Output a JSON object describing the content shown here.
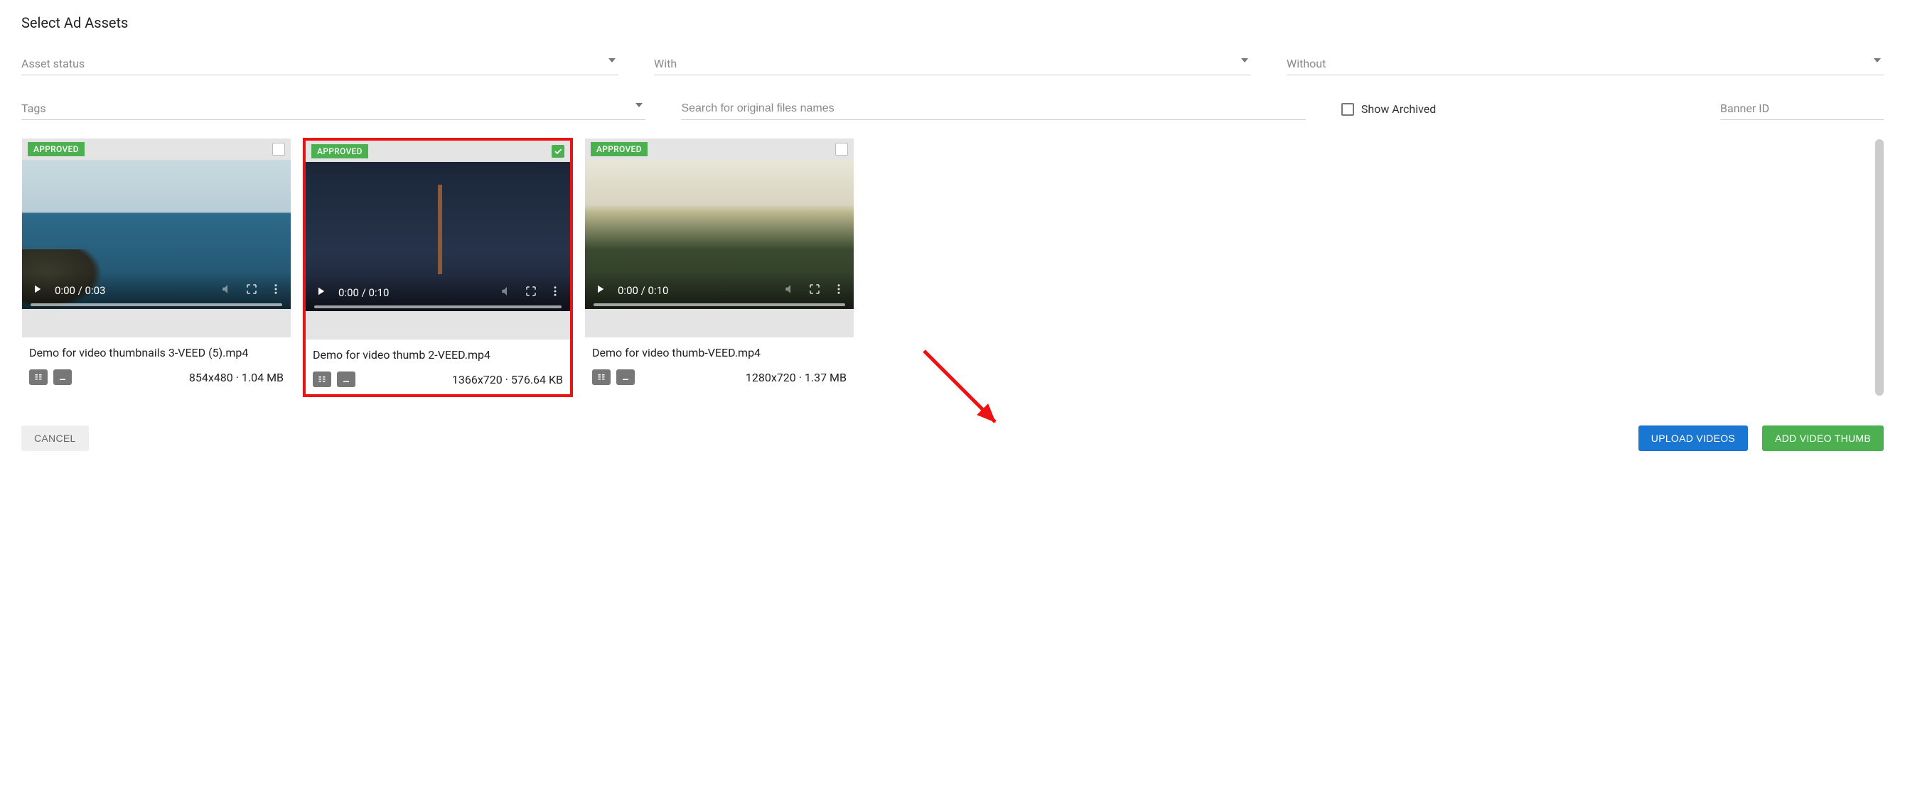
{
  "page": {
    "title": "Select Ad Assets"
  },
  "filters": {
    "asset_status": {
      "label": "Asset status"
    },
    "with": {
      "label": "With"
    },
    "without": {
      "label": "Without"
    },
    "tags": {
      "label": "Tags"
    },
    "search": {
      "placeholder": "Search for original files names"
    },
    "show_archived": {
      "label": "Show Archived"
    },
    "banner_id": {
      "label": "Banner ID"
    }
  },
  "assets": [
    {
      "status": "APPROVED",
      "selected": false,
      "time": "0:00 / 0:03",
      "filename": "Demo for video thumbnails 3-VEED (5).mp4",
      "meta": "854x480 · 1.04 MB",
      "highlighted": false
    },
    {
      "status": "APPROVED",
      "selected": true,
      "time": "0:00 / 0:10",
      "filename": "Demo for video thumb 2-VEED.mp4",
      "meta": "1366x720 · 576.64 KB",
      "highlighted": true
    },
    {
      "status": "APPROVED",
      "selected": false,
      "time": "0:00 / 0:10",
      "filename": "Demo for video thumb-VEED.mp4",
      "meta": "1280x720 · 1.37 MB",
      "highlighted": false
    }
  ],
  "actions": {
    "cancel": "CANCEL",
    "upload": "UPLOAD VIDEOS",
    "add_thumb": "ADD VIDEO THUMB"
  }
}
